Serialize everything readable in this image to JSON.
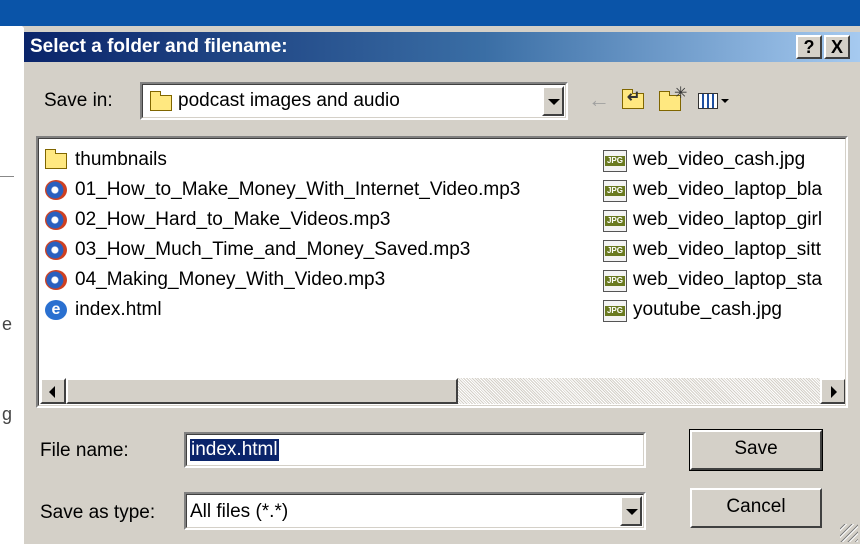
{
  "dialog": {
    "title": "Select a folder and filename:",
    "help_label": "?",
    "close_label": "X"
  },
  "save_in": {
    "label": "Save in:",
    "value": "podcast images and audio"
  },
  "toolbar": {
    "icons": [
      "back-arrow-icon",
      "up-one-level-icon",
      "create-new-folder-icon",
      "view-menu-icon"
    ]
  },
  "files": {
    "left_column": [
      {
        "name": "thumbnails",
        "icon": "folder-icon"
      },
      {
        "name": "01_How_to_Make_Money_With_Internet_Video.mp3",
        "icon": "mp3-audio-icon"
      },
      {
        "name": "02_How_Hard_to_Make_Videos.mp3",
        "icon": "mp3-audio-icon"
      },
      {
        "name": "03_How_Much_Time_and_Money_Saved.mp3",
        "icon": "mp3-audio-icon"
      },
      {
        "name": "04_Making_Money_With_Video.mp3",
        "icon": "mp3-audio-icon"
      },
      {
        "name": "index.html",
        "icon": "html-file-icon"
      }
    ],
    "right_column": [
      {
        "name": "web_video_cash.jpg",
        "icon": "jpg-file-icon"
      },
      {
        "name": "web_video_laptop_bla",
        "icon": "jpg-file-icon"
      },
      {
        "name": "web_video_laptop_girl",
        "icon": "jpg-file-icon"
      },
      {
        "name": "web_video_laptop_sitt",
        "icon": "jpg-file-icon"
      },
      {
        "name": "web_video_laptop_sta",
        "icon": "jpg-file-icon"
      },
      {
        "name": "youtube_cash.jpg",
        "icon": "jpg-file-icon"
      }
    ],
    "jpg_badge": "JPG"
  },
  "file_name": {
    "label": "File name:",
    "value": "index.html"
  },
  "save_as_type": {
    "label": "Save as type:",
    "value": "All files (*.*)"
  },
  "buttons": {
    "save": "Save",
    "cancel": "Cancel"
  },
  "background_fragments": [
    "e",
    "g"
  ],
  "colors": {
    "title_start": "#0a246a",
    "title_end": "#a6caf0",
    "face": "#d4d0c8",
    "selection": "#0a246a"
  }
}
